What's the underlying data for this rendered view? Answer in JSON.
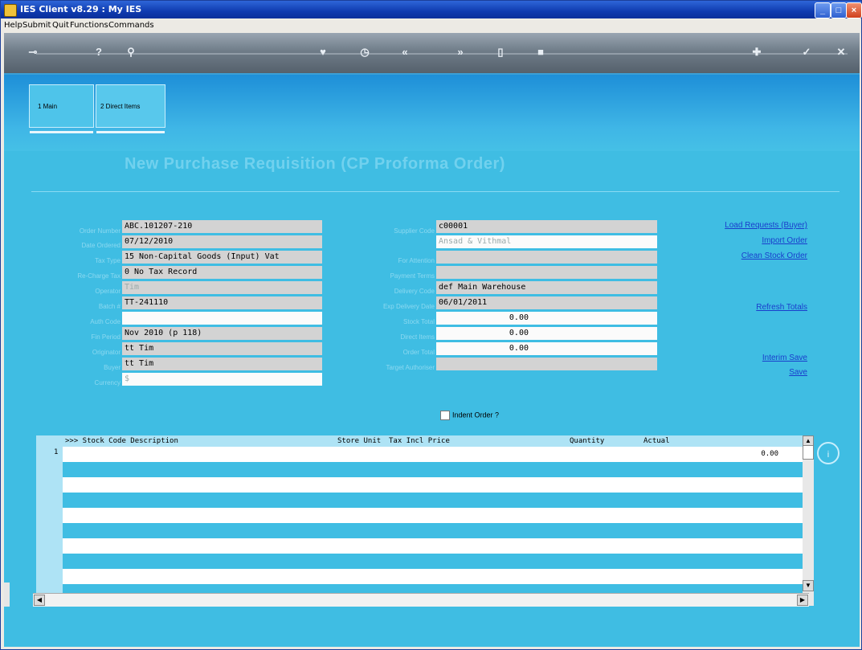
{
  "window": {
    "title": "IES Client v8.29 : My IES"
  },
  "menu": [
    "Help",
    "Submit",
    "Quit",
    "Functions",
    "Commands"
  ],
  "tabs": [
    {
      "label": "1 Main"
    },
    {
      "label": "2 Direct Items"
    }
  ],
  "heading": "New Purchase Requisition (CP Proforma Order)",
  "left_fields": [
    {
      "label": "Order Number",
      "value": "ABC.101207-210"
    },
    {
      "label": "Date Ordered",
      "value": "07/12/2010"
    },
    {
      "label": "Tax Type",
      "value": "15 Non-Capital Goods (Input) Vat"
    },
    {
      "label": "Re-Charge Tax",
      "value": "0 No Tax Record"
    },
    {
      "label": "Operator",
      "value": "Tim"
    },
    {
      "label": "Batch #",
      "value": "TT-241110"
    },
    {
      "label": "Auth Code",
      "value": ""
    },
    {
      "label": "Fin Period",
      "value": "Nov 2010 (p 118)"
    },
    {
      "label": "Originator",
      "value": "tt Tim"
    },
    {
      "label": "Buyer",
      "value": "tt Tim"
    },
    {
      "label": "Currency",
      "value": "$"
    }
  ],
  "right_fields": [
    {
      "label": "Supplier Code",
      "value": "c00001"
    },
    {
      "label": "",
      "value": "Ansad & Vithmal"
    },
    {
      "label": "For Attention",
      "value": ""
    },
    {
      "label": "Payment Terms",
      "value": ""
    },
    {
      "label": "Delivery Code",
      "value": "def Main Warehouse"
    },
    {
      "label": "Exp Delivery Date",
      "value": "06/01/2011"
    },
    {
      "label": "Stock Total",
      "value": "0.00"
    },
    {
      "label": "Direct Items",
      "value": "0.00"
    },
    {
      "label": "Order Total",
      "value": "0.00"
    },
    {
      "label": "Target Authoriser",
      "value": ""
    }
  ],
  "links": {
    "load_requests": "Load Requests (Buyer)",
    "import_order": "Import Order",
    "clean_stock_order": "Clean Stock Order",
    "refresh_totals": "Refresh Totals",
    "interim_save": "Interim Save",
    "save": "Save"
  },
  "indent_label": "Indent Order ?",
  "grid": {
    "columns": [
      ">>> Stock Code Description",
      "Store Unit",
      "Tax Incl Price",
      "Quantity",
      "Actual"
    ],
    "rows": [
      {
        "num": "1",
        "actual": "0.00"
      }
    ]
  },
  "colors": {
    "accent": "#3fbde3",
    "title_bar": "#0f3bb0",
    "link": "#1a3ecc"
  }
}
